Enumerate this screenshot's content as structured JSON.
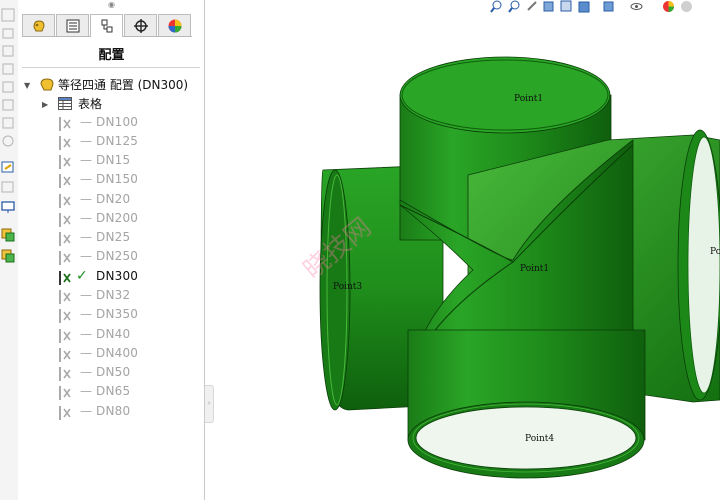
{
  "feature_manager": {
    "tabs": [
      {
        "name": "feature-tree"
      },
      {
        "name": "property-manager"
      },
      {
        "name": "configuration-manager"
      },
      {
        "name": "dimxpert-manager"
      },
      {
        "name": "display-manager"
      }
    ],
    "title": "配置",
    "root": {
      "label": "等径四通 配置  (DN300)"
    },
    "table_node": {
      "label": "表格"
    },
    "configurations": [
      {
        "label": "DN100",
        "active": false
      },
      {
        "label": "DN125",
        "active": false
      },
      {
        "label": "DN15",
        "active": false
      },
      {
        "label": "DN150",
        "active": false
      },
      {
        "label": "DN20",
        "active": false
      },
      {
        "label": "DN200",
        "active": false
      },
      {
        "label": "DN25",
        "active": false
      },
      {
        "label": "DN250",
        "active": false
      },
      {
        "label": "DN300",
        "active": true
      },
      {
        "label": "DN32",
        "active": false
      },
      {
        "label": "DN350",
        "active": false
      },
      {
        "label": "DN40",
        "active": false
      },
      {
        "label": "DN400",
        "active": false
      },
      {
        "label": "DN50",
        "active": false
      },
      {
        "label": "DN65",
        "active": false
      },
      {
        "label": "DN80",
        "active": false
      }
    ]
  },
  "viewport": {
    "model_color": "#1f8f1b",
    "model_color_dark": "#0f5f0d",
    "model_color_light": "#45b534",
    "points": [
      "Point1",
      "Point1",
      "Point3",
      "Point4",
      "Point"
    ],
    "watermark": "晓技网"
  },
  "view_toolbar": {
    "icons": [
      "zoom-to-fit-icon",
      "zoom-area-icon",
      "previous-view-icon",
      "section-view-icon",
      "view-orientation-icon",
      "display-style-icon",
      "hide-show-icon",
      "edit-appearance-icon",
      "apply-scene-icon"
    ]
  }
}
